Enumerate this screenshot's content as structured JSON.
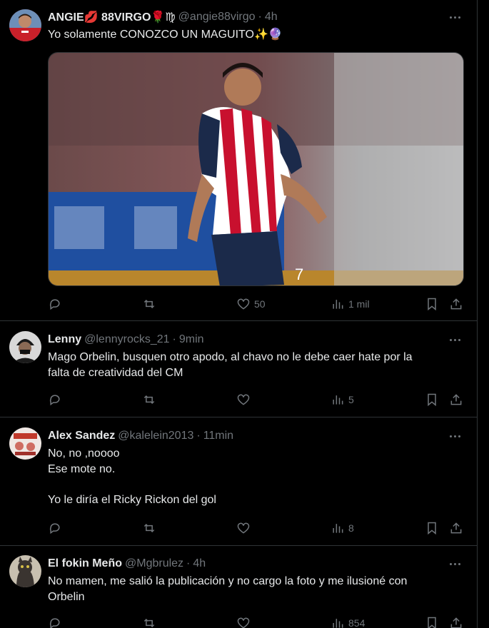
{
  "posts": [
    {
      "name": "ANGIE💋 88VIRGO🌹♍",
      "handle": "@angie88virgo",
      "time": "4h",
      "lines": [
        "Yo solamente CONOZCO UN MAGUITO✨🔮"
      ],
      "replies": "",
      "reposts": "",
      "likes": "50",
      "views": "1 mil",
      "has_image": true,
      "image_description": "Player in red-and-white striped jersey with number 7 on shorts"
    },
    {
      "name": "Lenny",
      "handle": "@lennyrocks_21",
      "time": "9min",
      "lines": [
        "Mago Orbelin, busquen otro apodo, al chavo no le debe caer hate por la",
        "falta de creatividad del CM"
      ],
      "likes": "",
      "views": "5"
    },
    {
      "name": "Alex Sandez",
      "handle": "@kalelein2013",
      "time": "11min",
      "lines": [
        "No, no ,noooo",
        "Ese mote no.",
        "",
        "Yo le diría el Ricky Rickon del gol"
      ],
      "likes": "",
      "views": "8"
    },
    {
      "name": "El fokin Meño",
      "handle": "@Mgbrulez",
      "time": "4h",
      "lines": [
        "No mamen, me salió la publicación y no cargo la foto y me ilusioné con",
        "Orbelin"
      ],
      "likes": "",
      "views": "854"
    }
  ],
  "separator": "·",
  "icons": {
    "reply": "reply-icon",
    "repost": "repost-icon",
    "like": "heart-icon",
    "views": "views-icon",
    "bookmark": "bookmark-icon",
    "share": "share-icon",
    "more": "more-icon"
  },
  "colors": {
    "background": "#000000",
    "text": "#e7e9ea",
    "secondary": "#71767b",
    "border": "#2f3336"
  }
}
